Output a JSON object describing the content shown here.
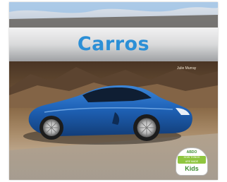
{
  "cover": {
    "title": "Carros",
    "author": "Julie Murray"
  },
  "badge": {
    "top": "ABDO",
    "band_line1": "HOW THINGS",
    "band_line2": "ARE MADE",
    "bottom": "Kids"
  },
  "colors": {
    "title_blue": "#2c8fd6",
    "car_blue": "#1f63b8",
    "badge_green": "#8fc53f"
  }
}
